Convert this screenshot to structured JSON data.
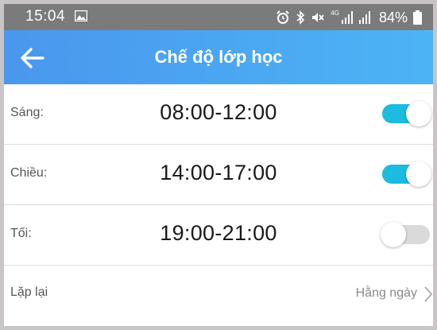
{
  "status_bar": {
    "time": "15:04",
    "network": "4G",
    "battery": "84%"
  },
  "app_bar": {
    "title": "Chế độ lớp học"
  },
  "schedule": [
    {
      "label": "Sáng:",
      "time": "08:00-12:00",
      "enabled": true
    },
    {
      "label": "Chiều:",
      "time": "14:00-17:00",
      "enabled": true
    },
    {
      "label": "Tối:",
      "time": "19:00-21:00",
      "enabled": false
    }
  ],
  "repeat": {
    "label": "Lặp lại",
    "value": "Hằng ngày"
  },
  "colors": {
    "accent": "#1cbbe0",
    "app_bar_start": "#4a97ee",
    "app_bar_end": "#4cb4f5",
    "status_bar": "#7b7b7b"
  },
  "icons": {
    "back": "arrow-left-icon",
    "repeat": "chevron-right-icon",
    "status": [
      "gallery-icon",
      "alarm-icon",
      "bluetooth-icon",
      "mute-icon",
      "signal-icon",
      "battery-icon"
    ]
  }
}
